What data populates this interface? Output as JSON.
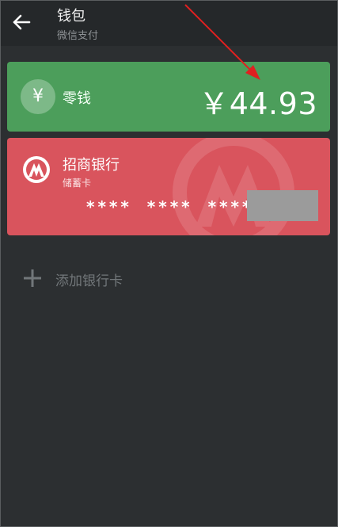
{
  "header": {
    "title": "钱包",
    "subtitle": "微信支付",
    "back_icon": "arrow-left-icon"
  },
  "change_card": {
    "icon_glyph": "¥",
    "label": "零钱",
    "amount": "￥44.93",
    "color": "#4c9e5b"
  },
  "bank_card": {
    "name": "招商银行",
    "card_type": "储蓄卡",
    "masked_number": "**** **** ****",
    "color": "#d9545d"
  },
  "add_card": {
    "label": "添加银行卡",
    "icon": "plus-icon"
  },
  "annotation": {
    "color": "#e02020",
    "icon": "red-arrow"
  }
}
